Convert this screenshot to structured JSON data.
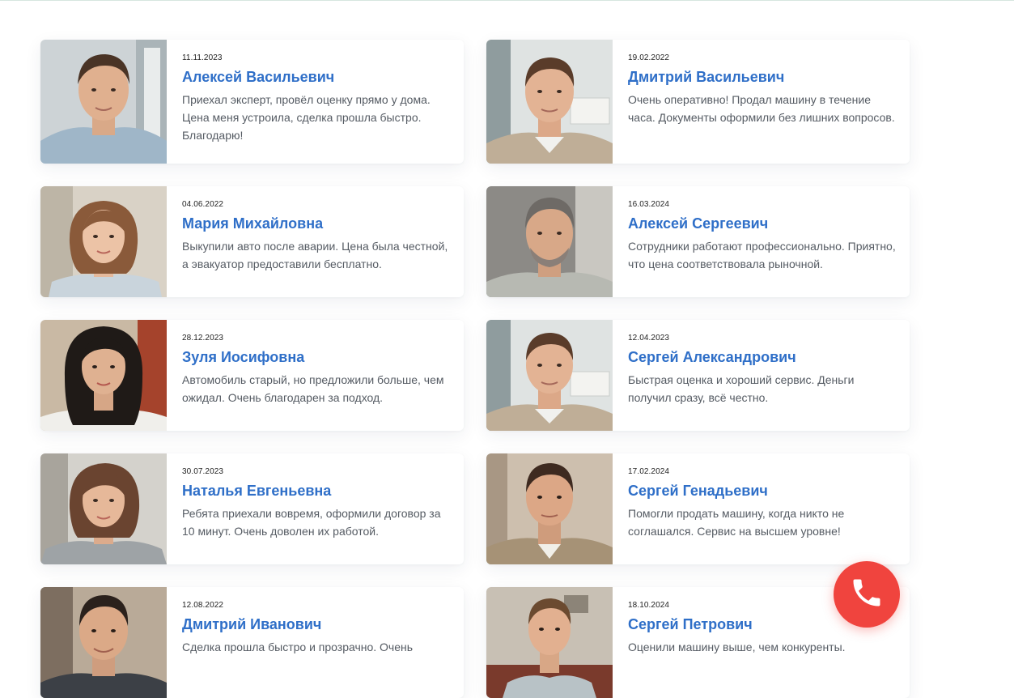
{
  "reviews": [
    {
      "date": "11.11.2023",
      "name": "Алексей Васильевич",
      "text": "Приехал эксперт, провёл оценку прямо у дома. Цена меня устроила, сделка прошла быстро. Благодарю!",
      "photo": "man-portrait"
    },
    {
      "date": "19.02.2022",
      "name": "Дмитрий Васильевич",
      "text": "Очень оперативно! Продал машину в течение часа. Документы оформили без лишних вопросов.",
      "photo": "man-portrait"
    },
    {
      "date": "04.06.2022",
      "name": "Мария Михайловна",
      "text": "Выкупили авто после аварии. Цена была честной, а эвакуатор предоставили бесплатно.",
      "photo": "woman-portrait"
    },
    {
      "date": "16.03.2024",
      "name": "Алексей Сергеевич",
      "text": "Сотрудники работают профессионально. Приятно, что цена соответствовала рыночной.",
      "photo": "man-portrait"
    },
    {
      "date": "28.12.2023",
      "name": "Зуля Иосифовна",
      "text": "Автомобиль старый, но предложили больше, чем ожидал. Очень благодарен за подход.",
      "photo": "woman-portrait"
    },
    {
      "date": "12.04.2023",
      "name": "Сергей Александрович",
      "text": "Быстрая оценка и хороший сервис. Деньги получил сразу, всё честно.",
      "photo": "man-portrait"
    },
    {
      "date": "30.07.2023",
      "name": "Наталья Евгеньевна",
      "text": "Ребята приехали вовремя, оформили договор за 10 минут. Очень доволен их работой.",
      "photo": "woman-portrait"
    },
    {
      "date": "17.02.2024",
      "name": "Сергей Генадьевич",
      "text": "Помогли продать машину, когда никто не соглашался. Сервис на высшем уровне!",
      "photo": "man-portrait"
    },
    {
      "date": "12.08.2022",
      "name": "Дмитрий Иванович",
      "text": "Сделка прошла быстро и прозрачно. Очень",
      "photo": "man-portrait"
    },
    {
      "date": "18.10.2024",
      "name": "Сергей Петрович",
      "text": "Оценили машину выше, чем конкуренты.",
      "photo": "man-portrait"
    }
  ],
  "call_button": {
    "icon": "phone-icon",
    "color": "#f0443e"
  },
  "colors": {
    "name": "#2f6fc8",
    "text": "#555b63",
    "accent": "#f0443e"
  }
}
